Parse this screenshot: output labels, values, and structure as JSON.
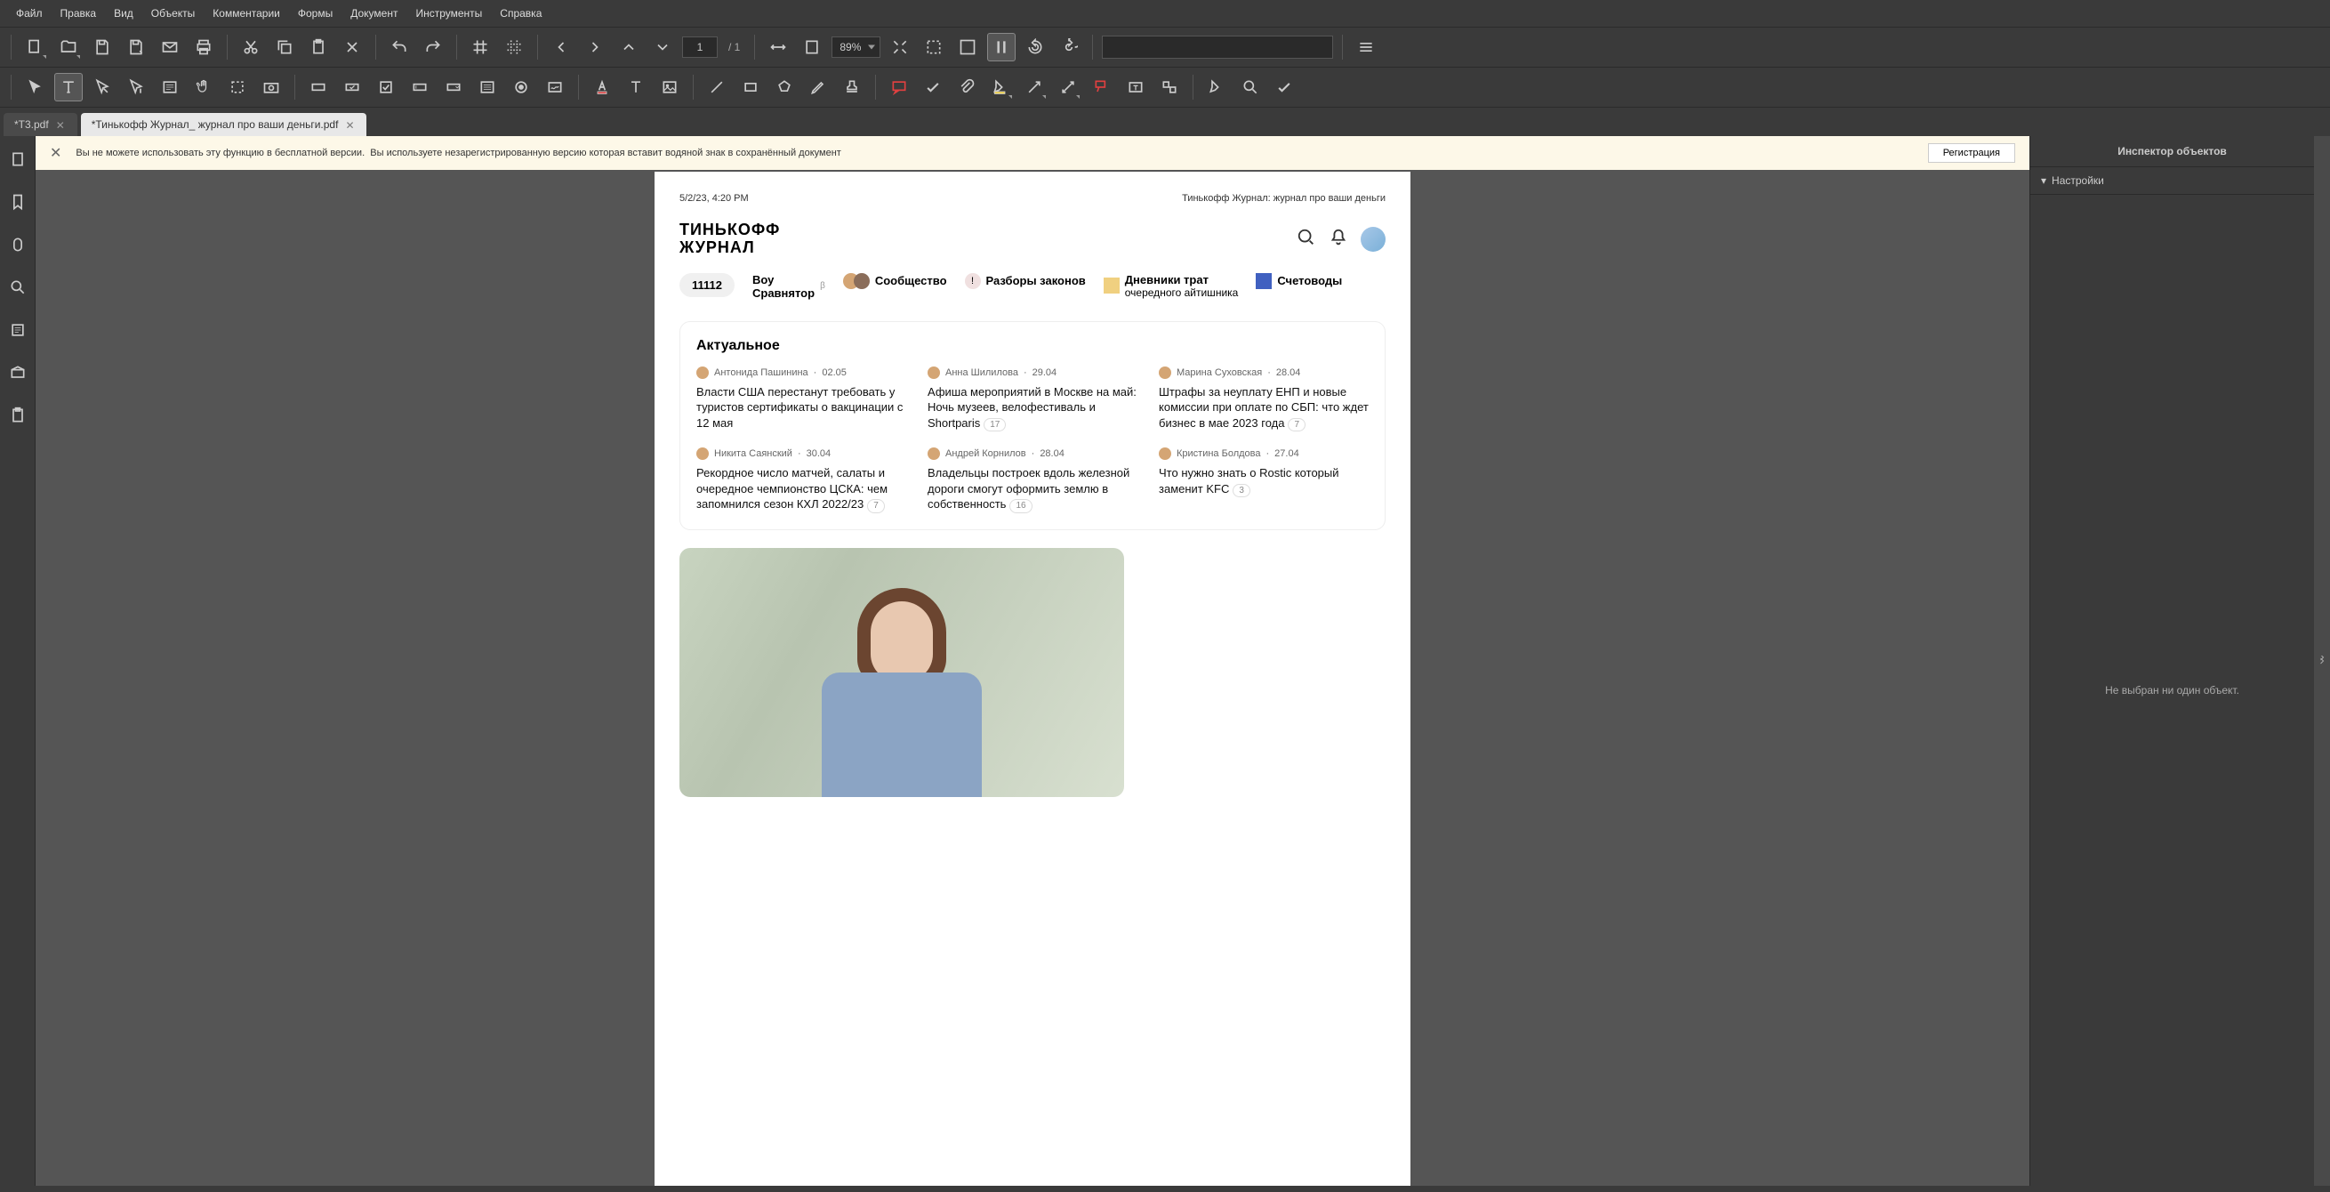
{
  "menu": [
    "Файл",
    "Правка",
    "Вид",
    "Объекты",
    "Комментарии",
    "Формы",
    "Документ",
    "Инструменты",
    "Справка"
  ],
  "page": {
    "current": "1",
    "total": "/ 1"
  },
  "zoom": "89%",
  "search_placeholder": "",
  "tabs": [
    {
      "label": "*T3.pdf",
      "active": false
    },
    {
      "label": "*Тинькофф Журнал_ журнал про ваши деньги.pdf",
      "active": true
    }
  ],
  "warning": {
    "text1": "Вы не можете использовать эту функцию в бесплатной версии.",
    "text2": "Вы используете незарегистрированную версию которая вставит водяной знак в сохранённый документ",
    "button": "Регистрация"
  },
  "doc": {
    "timestamp": "5/2/23, 4:20 PM",
    "title": "Тинькофф Журнал: журнал про ваши деньги",
    "brand1": "ТИНЬКОФФ",
    "brand2": "ЖУРНАЛ",
    "nav": {
      "num": "11112",
      "comparer1": "Воу",
      "comparer2": "Сравнятор",
      "beta": "β",
      "community": "Сообщество",
      "laws": "Разборы законов",
      "diaries1": "Дневники трат",
      "diaries2": "очередного айтишника",
      "accountants": "Счетоводы"
    },
    "section_title": "Актуальное",
    "articles": [
      {
        "author": "Антонида Пашинина",
        "date": "02.05",
        "title": "Власти США перестанут требовать у туристов сертификаты о вакцинации с 12 мая",
        "count": ""
      },
      {
        "author": "Анна Шилилова",
        "date": "29.04",
        "title": "Афиша мероприятий в Москве на май: Ночь музеев, велофестиваль и Shortparis",
        "count": "17"
      },
      {
        "author": "Марина Суховская",
        "date": "28.04",
        "title": "Штрафы за неуплату ЕНП и новые комиссии при оплате по СБП: что ждет бизнес в мае 2023 года",
        "count": "7"
      },
      {
        "author": "Никита Саянский",
        "date": "30.04",
        "title": "Рекордное число матчей, салаты и очередное чемпионство ЦСКА: чем запомнился сезон КХЛ 2022/23",
        "count": "7"
      },
      {
        "author": "Андрей Корнилов",
        "date": "28.04",
        "title": "Владельцы построек вдоль железной дороги смогут оформить землю в собственность",
        "count": "16"
      },
      {
        "author": "Кристина Болдова",
        "date": "27.04",
        "title": "Что нужно знать о Rostic который заменит KFC",
        "count": "3"
      }
    ]
  },
  "inspector": {
    "title": "Инспектор объектов",
    "settings": "Настройки",
    "empty": "Не выбран ни один объект."
  }
}
